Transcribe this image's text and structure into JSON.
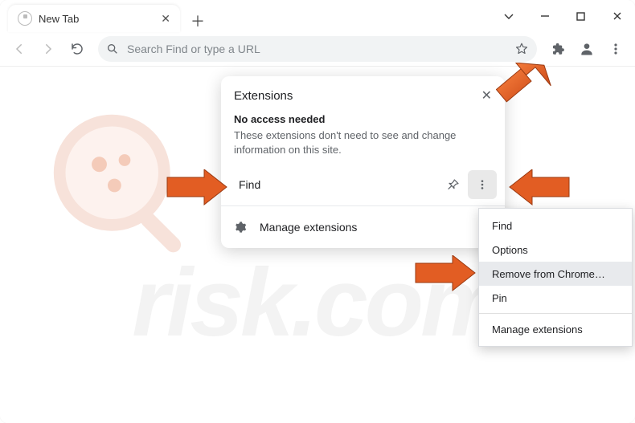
{
  "tab": {
    "title": "New Tab"
  },
  "omnibox": {
    "placeholder": "Search Find or type a URL"
  },
  "extPopup": {
    "title": "Extensions",
    "subhead": "No access needed",
    "desc": "These extensions don't need to see and change information on this site.",
    "ext_name": "Find",
    "manage": "Manage extensions"
  },
  "ctx": {
    "find": "Find",
    "options": "Options",
    "remove": "Remove from Chrome…",
    "pin": "Pin",
    "manage": "Manage extensions"
  },
  "watermark": "risk.com"
}
